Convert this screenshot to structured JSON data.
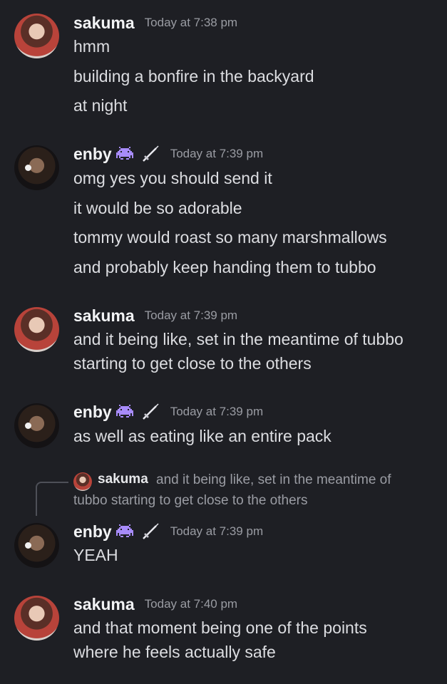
{
  "messages": [
    {
      "author": "sakuma",
      "time": "Today at 7:38 pm",
      "lines": [
        "hmm",
        "building a bonfire in the backyard",
        "at night"
      ]
    },
    {
      "author": "enby",
      "time": "Today at 7:39 pm",
      "lines": [
        "omg yes you should send it",
        "it would be so adorable",
        "tommy would roast so many marshmallows",
        "and probably keep handing them to tubbo"
      ]
    },
    {
      "author": "sakuma",
      "time": "Today at 7:39 pm",
      "lines": [
        "and it being like, set in the meantime of tubbo",
        "starting to get close to the others"
      ]
    },
    {
      "author": "enby",
      "time": "Today at 7:39 pm",
      "lines": [
        "as well as eating like an entire pack"
      ]
    },
    {
      "author": "enby",
      "time": "Today at 7:39 pm",
      "lines": [
        "YEAH"
      ]
    },
    {
      "author": "sakuma",
      "time": "Today at 7:40 pm",
      "lines": [
        "and that moment being one of the points",
        "where he feels actually safe"
      ]
    }
  ],
  "reply": {
    "author": "sakuma",
    "text_line1": "and it being like, set in the meantime of",
    "text_line2": "tubbo starting to get close to the others"
  },
  "icons": {
    "badge": "space-invader-icon",
    "badge_color": "#a78bfa",
    "role": "dagger-icon"
  }
}
